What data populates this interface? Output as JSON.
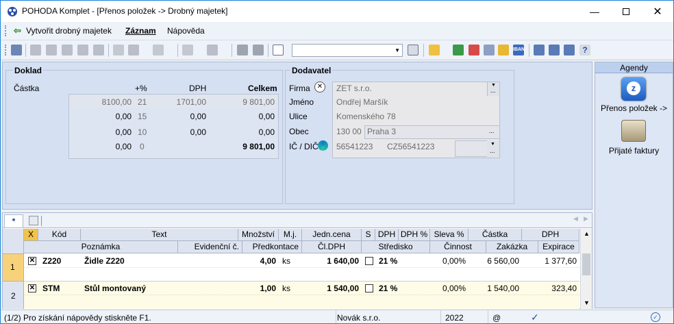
{
  "window": {
    "title": "POHODA Komplet - [Přenos položek -> Drobný majetek]"
  },
  "menu": {
    "create_label": "Vytvořit drobný majetek",
    "record_label": "Záznam",
    "help_label": "Nápověda"
  },
  "doklad": {
    "section_title": "Doklad",
    "castka_label": "Částka",
    "col_percent": "+%",
    "col_dph": "DPH",
    "col_celkem": "Celkem",
    "rows": [
      {
        "base": "8100,00",
        "percent": "21",
        "dph": "1701,00",
        "total": "9 801,00"
      },
      {
        "base": "0,00",
        "percent": "15",
        "dph": "0,00",
        "total": "0,00"
      },
      {
        "base": "0,00",
        "percent": "10",
        "dph": "0,00",
        "total": "0,00"
      },
      {
        "base": "0,00",
        "percent": "0",
        "dph": "",
        "total": "9 801,00"
      }
    ]
  },
  "dodavatel": {
    "section_title": "Dodavatel",
    "firma_label": "Firma",
    "firma_value": "ZET s.r.o.",
    "jmeno_label": "Jméno",
    "jmeno_value": "Ondřej Maršík",
    "ulice_label": "Ulice",
    "ulice_value": "Komenského 78",
    "obec_label": "Obec",
    "psc_value": "130 00",
    "obec_value": "Praha 3",
    "ic_label": "IČ / DIČ",
    "ic_value": "56541223",
    "dic_value": "CZ56541223"
  },
  "sidebar": {
    "title": "Agendy",
    "items": [
      {
        "label": "Přenos položek ->"
      },
      {
        "label": "Přijaté faktury"
      }
    ]
  },
  "grid": {
    "tab_star": "*",
    "header1": [
      "X",
      "Kód",
      "Text",
      "Množství",
      "M.j.",
      "Jedn.cena",
      "S",
      "DPH",
      "DPH %",
      "Sleva %",
      "Částka",
      "DPH"
    ],
    "header2": [
      "Poznámka",
      "Evidenční č.",
      "Předkontace",
      "Čl.DPH",
      "Středisko",
      "Činnost",
      "Zakázka",
      "Expirace"
    ],
    "rows": [
      {
        "num": "1",
        "code": "Z220",
        "text": "Židle Z220",
        "qty": "4,00",
        "unit": "ks",
        "price": "1 640,00",
        "vat": "21 %",
        "discount": "0,00%",
        "amount": "6 560,00",
        "dph": "1 377,60"
      },
      {
        "num": "2",
        "code": "STM",
        "text": "Stůl montovaný",
        "qty": "1,00",
        "unit": "ks",
        "price": "1 540,00",
        "vat": "21 %",
        "discount": "0,00%",
        "amount": "1 540,00",
        "dph": "323,40"
      }
    ]
  },
  "status": {
    "help_text": "(1/2) Pro získání nápovědy stiskněte F1.",
    "company": "Novák s.r.o.",
    "year": "2022",
    "at": "@"
  },
  "colors": {
    "accent": "#1883d7",
    "panel": "#d5e0f3",
    "row_current": "#f7d27a",
    "row_alt": "#fefbe6"
  }
}
